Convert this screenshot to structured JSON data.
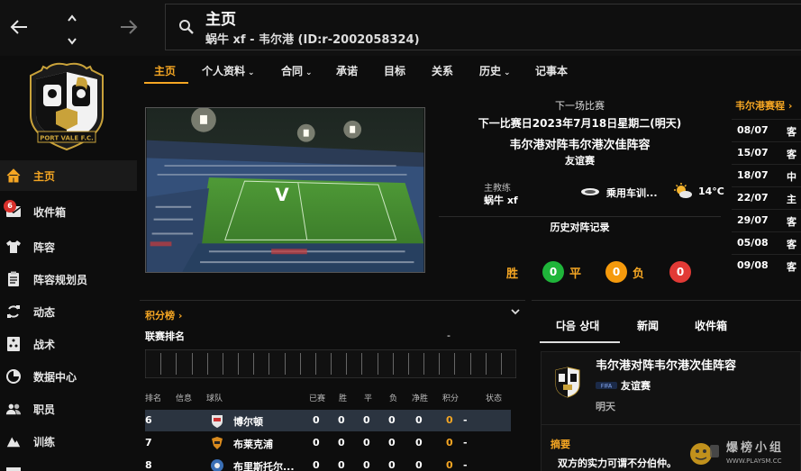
{
  "header": {
    "title": "主页",
    "subtitle": "蜗牛 xf - 韦尔港 (ID:r-2002058324)"
  },
  "club": {
    "logo_text": "PORT VALE F.C."
  },
  "sidebar": {
    "items": [
      {
        "label": "主页",
        "icon": "home-icon",
        "active": true
      },
      {
        "label": "收件箱",
        "icon": "inbox-icon",
        "badge": "6"
      },
      {
        "label": "阵容",
        "icon": "shirt-icon"
      },
      {
        "label": "阵容规划员",
        "icon": "clipboard-icon"
      },
      {
        "label": "动态",
        "icon": "refresh-icon"
      },
      {
        "label": "战术",
        "icon": "tactics-icon"
      },
      {
        "label": "数据中心",
        "icon": "data-icon"
      },
      {
        "label": "职员",
        "icon": "staff-icon"
      },
      {
        "label": "训练",
        "icon": "training-icon"
      }
    ]
  },
  "tabs": [
    {
      "label": "主页",
      "active": true
    },
    {
      "label": "个人资料",
      "dropdown": true
    },
    {
      "label": "合同",
      "dropdown": true
    },
    {
      "label": "承诺"
    },
    {
      "label": "目标"
    },
    {
      "label": "关系"
    },
    {
      "label": "历史",
      "dropdown": true
    },
    {
      "label": "记事本"
    }
  ],
  "next_match": {
    "heading": "下一场比赛",
    "date": "下一比赛日2023年7月18日星期二(明天)",
    "fixture": "韦尔港对阵韦尔港次佳阵容",
    "type": "友谊赛",
    "coach_label": "主教练",
    "coach_name": "蜗牛 xf",
    "venue": "乘用车训...",
    "temperature": "14°C",
    "h2h_title": "历史对阵记录",
    "h2h": {
      "win_label": "胜",
      "win": "0",
      "draw_label": "平",
      "draw": "0",
      "loss_label": "负",
      "loss": "0"
    }
  },
  "fixtures": {
    "title": "韦尔港赛程 ›",
    "rows": [
      {
        "date": "08/07",
        "venue": "客"
      },
      {
        "date": "15/07",
        "venue": "客"
      },
      {
        "date": "18/07",
        "venue": "中"
      },
      {
        "date": "22/07",
        "venue": "主"
      },
      {
        "date": "29/07",
        "venue": "客"
      },
      {
        "date": "05/08",
        "venue": "客"
      },
      {
        "date": "09/08",
        "venue": "客"
      }
    ]
  },
  "league": {
    "title": "积分榜 ›",
    "subtitle": "联赛排名",
    "dash": "-",
    "headers": [
      "排名",
      "信息",
      "球队",
      "已赛",
      "胜",
      "平",
      "负",
      "净胜",
      "积分",
      "状态"
    ],
    "rows": [
      {
        "rank": "6",
        "team": "博尔顿",
        "played": "0",
        "won": "0",
        "drawn": "0",
        "lost": "0",
        "gd": "0",
        "points": "0",
        "form": "-",
        "highlight": true
      },
      {
        "rank": "7",
        "team": "布莱克浦",
        "played": "0",
        "won": "0",
        "drawn": "0",
        "lost": "0",
        "gd": "0",
        "points": "0",
        "form": "-"
      },
      {
        "rank": "8",
        "team": "布里斯托尔...",
        "played": "0",
        "won": "0",
        "drawn": "0",
        "lost": "0",
        "gd": "0",
        "points": "0",
        "form": "-"
      }
    ]
  },
  "right_panel": {
    "tabs": [
      "다음 상대",
      "新闻",
      "收件箱"
    ],
    "card": {
      "title": "韦尔港对阵韦尔港次佳阵容",
      "type": "友谊赛",
      "when": "明天",
      "summary_title": "摘要",
      "summary_text": "双方的实力可谓不分伯仲。"
    }
  },
  "watermark": {
    "text": "爆榜小组",
    "url": "WWW.PLAYSM.CC"
  },
  "colors": {
    "accent": "#f5a623",
    "win": "#1fb53a",
    "draw": "#f59a0c",
    "loss": "#e23a36",
    "highlight_row": "#2b3440"
  }
}
